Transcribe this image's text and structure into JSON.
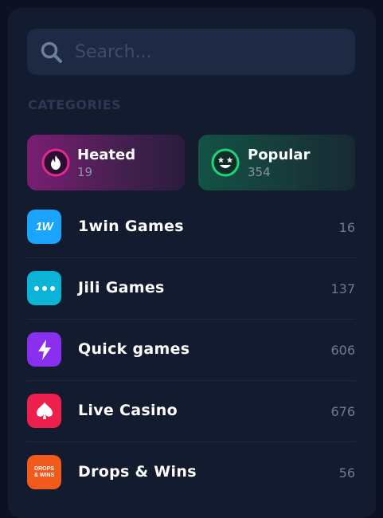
{
  "search": {
    "placeholder": "Search..."
  },
  "categories": {
    "title": "CATEGORIES",
    "featured": [
      {
        "name": "Heated",
        "count": "19",
        "icon": "flame-icon",
        "color": "#e0298f"
      },
      {
        "name": "Popular",
        "count": "354",
        "icon": "star-eyes-icon",
        "color": "#1fd37a"
      }
    ],
    "items": [
      {
        "label": "1win Games",
        "count": "16",
        "icon": "1win-logo-icon",
        "icon_text": "1W",
        "color": "#1aa3ff"
      },
      {
        "label": "Jili Games",
        "count": "137",
        "icon": "dots-icon",
        "color": "#0ab4d6"
      },
      {
        "label": "Quick games",
        "count": "606",
        "icon": "lightning-icon",
        "color": "#8a2ff0"
      },
      {
        "label": "Live Casino",
        "count": "676",
        "icon": "spade-icon",
        "color": "#ec1f4d"
      },
      {
        "label": "Drops & Wins",
        "count": "56",
        "icon": "drops-wins-icon",
        "icon_text": "DROPS & WINS",
        "color": "#f25a1c"
      }
    ]
  }
}
